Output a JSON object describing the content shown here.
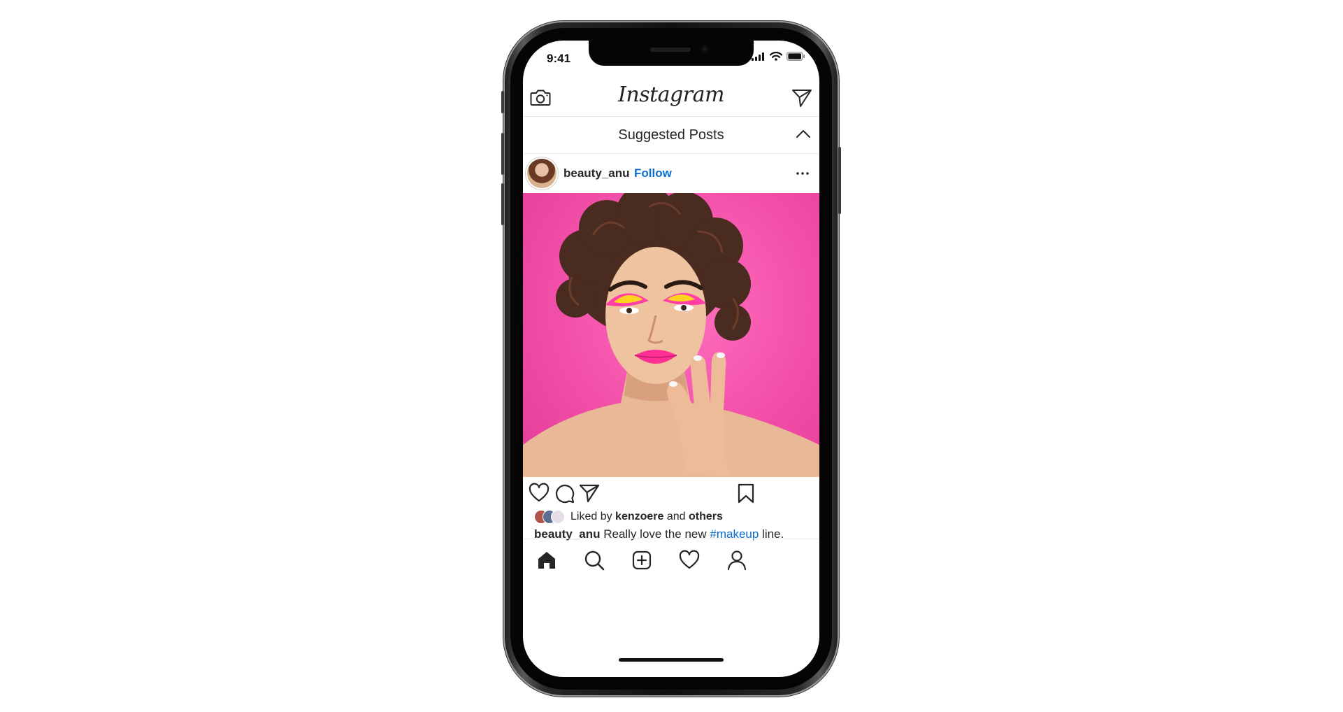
{
  "status_bar": {
    "time": "9:41"
  },
  "header": {
    "logo": "Instagram"
  },
  "section": {
    "title": "Suggested Posts"
  },
  "post": {
    "username": "beauty_anu",
    "follow_label": "Follow",
    "image_alt": "woman-with-colorful-makeup-photo",
    "likes": {
      "prefix": "Liked by",
      "user": "kenzoere",
      "joiner": "and",
      "others": "others"
    },
    "caption": {
      "username": "beauty_anu",
      "text": "Really love the new",
      "hashtag": "#makeup",
      "suffix": "line."
    }
  },
  "colors": {
    "link_blue": "#0a6ed1",
    "post_bg_pink": "#f24fa8",
    "text": "#262626"
  },
  "icons": {
    "camera": "camera-icon",
    "direct": "paper-plane-icon",
    "collapse": "chevron-up-icon",
    "more": "more-horizontal-icon",
    "like": "heart-icon",
    "comment": "comment-icon",
    "share": "paper-plane-icon",
    "save": "bookmark-icon",
    "home": "home-icon",
    "search": "search-icon",
    "add": "add-post-icon",
    "activity": "heart-icon",
    "profile": "profile-icon"
  }
}
